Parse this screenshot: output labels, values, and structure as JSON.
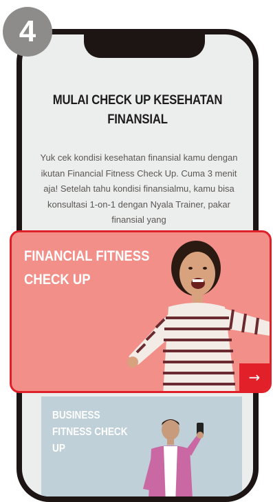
{
  "step": {
    "number": "4"
  },
  "intro": {
    "title": "MULAI CHECK UP KESEHATAN FINANSIAL",
    "description": "Yuk cek kondisi kesehatan finansial kamu dengan ikutan Financial Fitness Check Up. Cuma 3 menit aja! Setelah tahu kondisi finansialmu, kamu bisa konsultasi 1-on-1 dengan Nyala Trainer, pakar finansial yang"
  },
  "cards": {
    "financial": {
      "title": "FINANCIAL FITNESS CHECK UP",
      "arrow": "→",
      "arrow_icon": "arrow-right-icon"
    },
    "business": {
      "title": "BUSINESS FITNESS CHECK UP"
    }
  },
  "colors": {
    "badge": "#8d8c8a",
    "phone_frame": "#1c1513",
    "screen_bg": "#eceeed",
    "financial_card_bg": "#f28f89",
    "highlight_border": "#e02028",
    "business_card_bg": "#bfd0d8",
    "arrow_button": "#e2202a"
  }
}
